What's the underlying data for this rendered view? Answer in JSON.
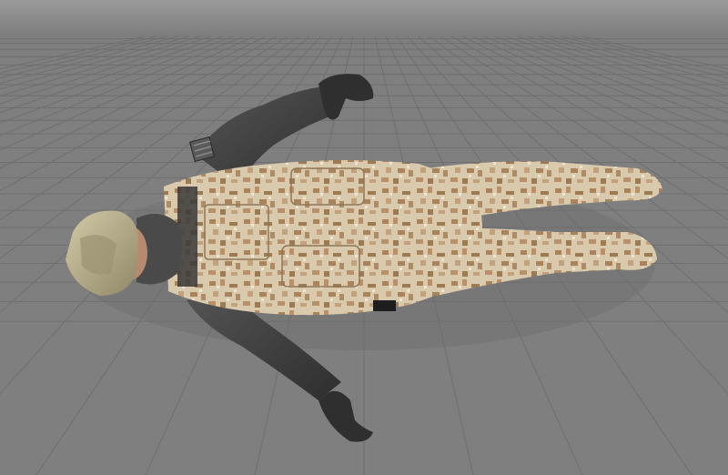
{
  "viewport": {
    "background_color": "#7f7f7f",
    "sky_color": "#9a9a9a",
    "grid_color": "#6f6f6f",
    "grid_visible": true
  },
  "model": {
    "subject": "soldier-character-model",
    "pose": "lying-on-back-arms-spread",
    "camo_base_color": "#d9c9ad",
    "camo_spot_color": "#a9835a",
    "sleeve_color": "#3e3e3e",
    "glove_color": "#2f2f2f",
    "helmet_color": "#b6ae8a",
    "mask_color": "#4a4a4a",
    "icons": [
      "flag-patch-icon"
    ]
  }
}
